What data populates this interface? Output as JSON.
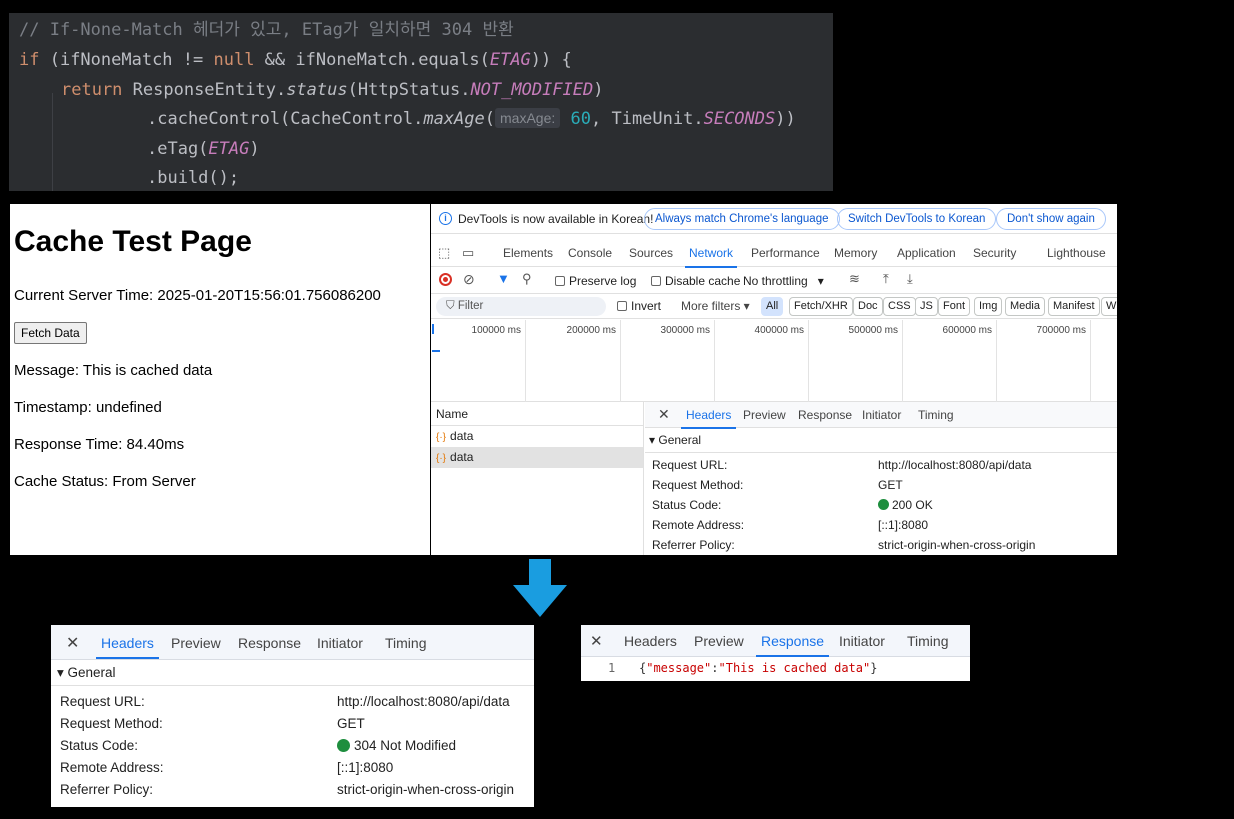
{
  "code": {
    "comment": "// If-None-Match 헤더가 있고, ETag가 일치하면 304 반환",
    "if_kw": "if",
    "if_cond_1": " (ifNoneMatch != ",
    "null_kw": "null",
    "if_cond_2": " && ifNoneMatch.equals(",
    "etag_const": "ETAG",
    "if_cond_3": ")) {",
    "return_kw": "return",
    "ret_1": " ResponseEntity.",
    "status_method": "status",
    "ret_2": "(HttpStatus.",
    "not_modified": "NOT_MODIFIED",
    "ret_3": ")",
    "cc_1": ".cacheControl(CacheControl.",
    "maxage_method": "maxAge",
    "cc_2": "(",
    "maxage_hint": "maxAge:",
    "maxage_value": "60",
    "cc_3": ", TimeUnit.",
    "seconds": "SECONDS",
    "cc_4": "))",
    "etag_call_1": ".eTag(",
    "etag_call_2": ")",
    "build": ".build();"
  },
  "page": {
    "title": "Cache Test Page",
    "server_time": "Current Server Time: 2025-01-20T15:56:01.756086200",
    "fetch_button": "Fetch Data",
    "message": "Message: This is cached data",
    "timestamp": "Timestamp: undefined",
    "response_time": "Response Time: 84.40ms",
    "cache_status": "Cache Status: From Server"
  },
  "devtools": {
    "info_text": "DevTools is now available in Korean!",
    "pill_match": "Always match Chrome's language",
    "pill_switch": "Switch DevTools to Korean",
    "pill_dont": "Don't show again",
    "tabs": [
      "Elements",
      "Console",
      "Sources",
      "Network",
      "Performance",
      "Memory",
      "Application",
      "Security",
      "Lighthouse"
    ],
    "active_tab": "Network",
    "preserve_log": "Preserve log",
    "disable_cache": "Disable cache",
    "throttling": "No throttling",
    "filter_placeholder": "Filter",
    "invert": "Invert",
    "more_filters": "More filters",
    "filter_chips": [
      "All",
      "Fetch/XHR",
      "Doc",
      "CSS",
      "JS",
      "Font",
      "Img",
      "Media",
      "Manifest",
      "WS"
    ],
    "timeline_labels": [
      "100000 ms",
      "200000 ms",
      "300000 ms",
      "400000 ms",
      "500000 ms",
      "600000 ms",
      "700000 ms"
    ],
    "name_header": "Name",
    "requests": [
      "data",
      "data"
    ],
    "detail_tabs": [
      "Headers",
      "Preview",
      "Response",
      "Initiator",
      "Timing"
    ],
    "general_label": "▾ General",
    "headers": {
      "request_url_k": "Request URL:",
      "request_url_v": "http://localhost:8080/api/data",
      "method_k": "Request Method:",
      "method_v": "GET",
      "status_k": "Status Code:",
      "status_v": "200 OK",
      "remote_k": "Remote Address:",
      "remote_v": "[::1]:8080",
      "referrer_k": "Referrer Policy:",
      "referrer_v": "strict-origin-when-cross-origin"
    }
  },
  "bottom_left": {
    "tabs": [
      "Headers",
      "Preview",
      "Response",
      "Initiator",
      "Timing"
    ],
    "general_label": "▾ General",
    "request_url_k": "Request URL:",
    "request_url_v": "http://localhost:8080/api/data",
    "method_k": "Request Method:",
    "method_v": "GET",
    "status_k": "Status Code:",
    "status_v": "304 Not Modified",
    "remote_k": "Remote Address:",
    "remote_v": "[::1]:8080",
    "referrer_k": "Referrer Policy:",
    "referrer_v": "strict-origin-when-cross-origin"
  },
  "bottom_right": {
    "tabs": [
      "Headers",
      "Preview",
      "Response",
      "Initiator",
      "Timing"
    ],
    "line_number": "1",
    "json_open": "{",
    "json_key": "\"message\"",
    "json_colon": ":",
    "json_value": "\"This is cached data\"",
    "json_close": "}"
  },
  "colors": {
    "accent": "#1a73e8",
    "status_ok": "#1e8e3e",
    "arrow": "#1a9de0",
    "code_bg": "#2b2d30"
  }
}
